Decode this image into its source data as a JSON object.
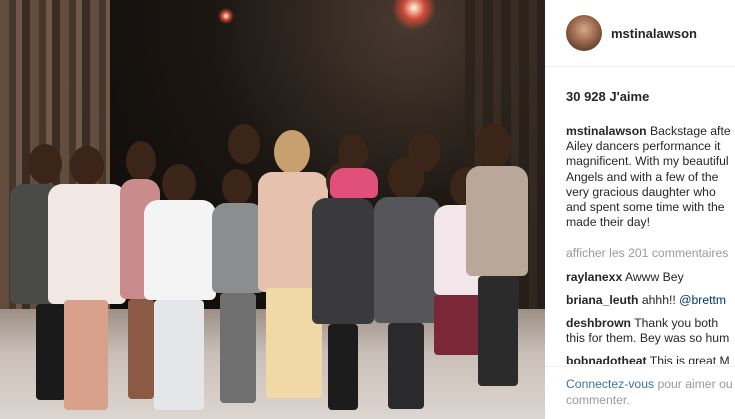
{
  "post": {
    "username": "mstinalawson",
    "likes": "30 928 J'aime",
    "caption_user": "mstinalawson",
    "caption_lines": [
      "Backstage afte",
      "Ailey dancers performance it",
      "magnificent. With my beautiful",
      "Angels and with a few of the",
      "very gracious daughter who",
      "and spent some time with the",
      "made their day!"
    ],
    "view_comments": "afficher les 201 commentaires",
    "comments": [
      {
        "user": "raylanexx",
        "text": "Awww Bey"
      },
      {
        "user": "briana_leuth",
        "text": "ahhh!! ",
        "mention": "@brettm"
      },
      {
        "user": "deshbrown",
        "text": "Thank you both",
        "line2": "this for them. Bey was so hum"
      },
      {
        "user": "bobnadotheat",
        "text": "This is great M"
      }
    ],
    "login_link": "Connectez-vous",
    "login_text_1": " pour aimer ou",
    "login_text_2": "commenter."
  },
  "photo": {
    "subject": "group photo backstage"
  }
}
